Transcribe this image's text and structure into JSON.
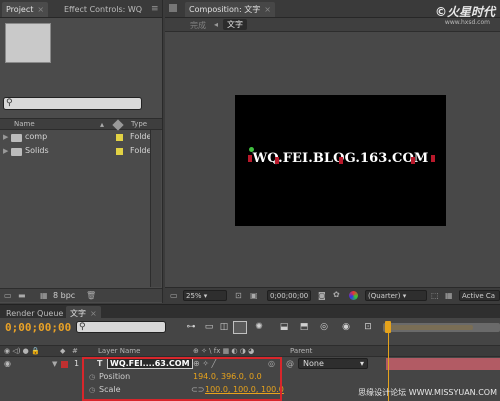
{
  "project_panel": {
    "tabs": [
      "Project",
      "Effect Controls: WQ"
    ],
    "close_glyph": "×",
    "columns": [
      "Name",
      "Type"
    ],
    "items": [
      {
        "name": "comp",
        "type": "Folde"
      },
      {
        "name": "Solids",
        "type": "Folde"
      }
    ],
    "bpc": "8 bpc"
  },
  "comp_panel": {
    "tab": "Composition: 文字",
    "breadcrumb_inactive": "完成",
    "breadcrumb_active": "文字",
    "comp_text": "WQ.FEI.BLOG.163.COM",
    "zoom": "25%",
    "time": "0;00;00;00",
    "resolution": "(Quarter)",
    "camera": "Active Ca",
    "canvas_color": "#000000"
  },
  "watermark": {
    "logo": "©火星时代",
    "url": "www.hxsd.com",
    "bottom": "思缘设计论坛 WWW.MISSYUAN.COM"
  },
  "timeline": {
    "tabs": [
      "Render Queue",
      "文字"
    ],
    "timecode": "0;00;00;00",
    "col_layer_name": "Layer Name",
    "col_parent": "Parent",
    "layer": {
      "index": "1",
      "name": "WQ.FEI....63.COM",
      "parent": "None"
    },
    "props": [
      {
        "name": "Position",
        "value": "194.0, 396.0, 0.0"
      },
      {
        "name": "Scale",
        "value": "100.0, 100.0, 100.0"
      }
    ],
    "accent": "#e8a31c",
    "layer_bar_color": "#b25b64"
  }
}
